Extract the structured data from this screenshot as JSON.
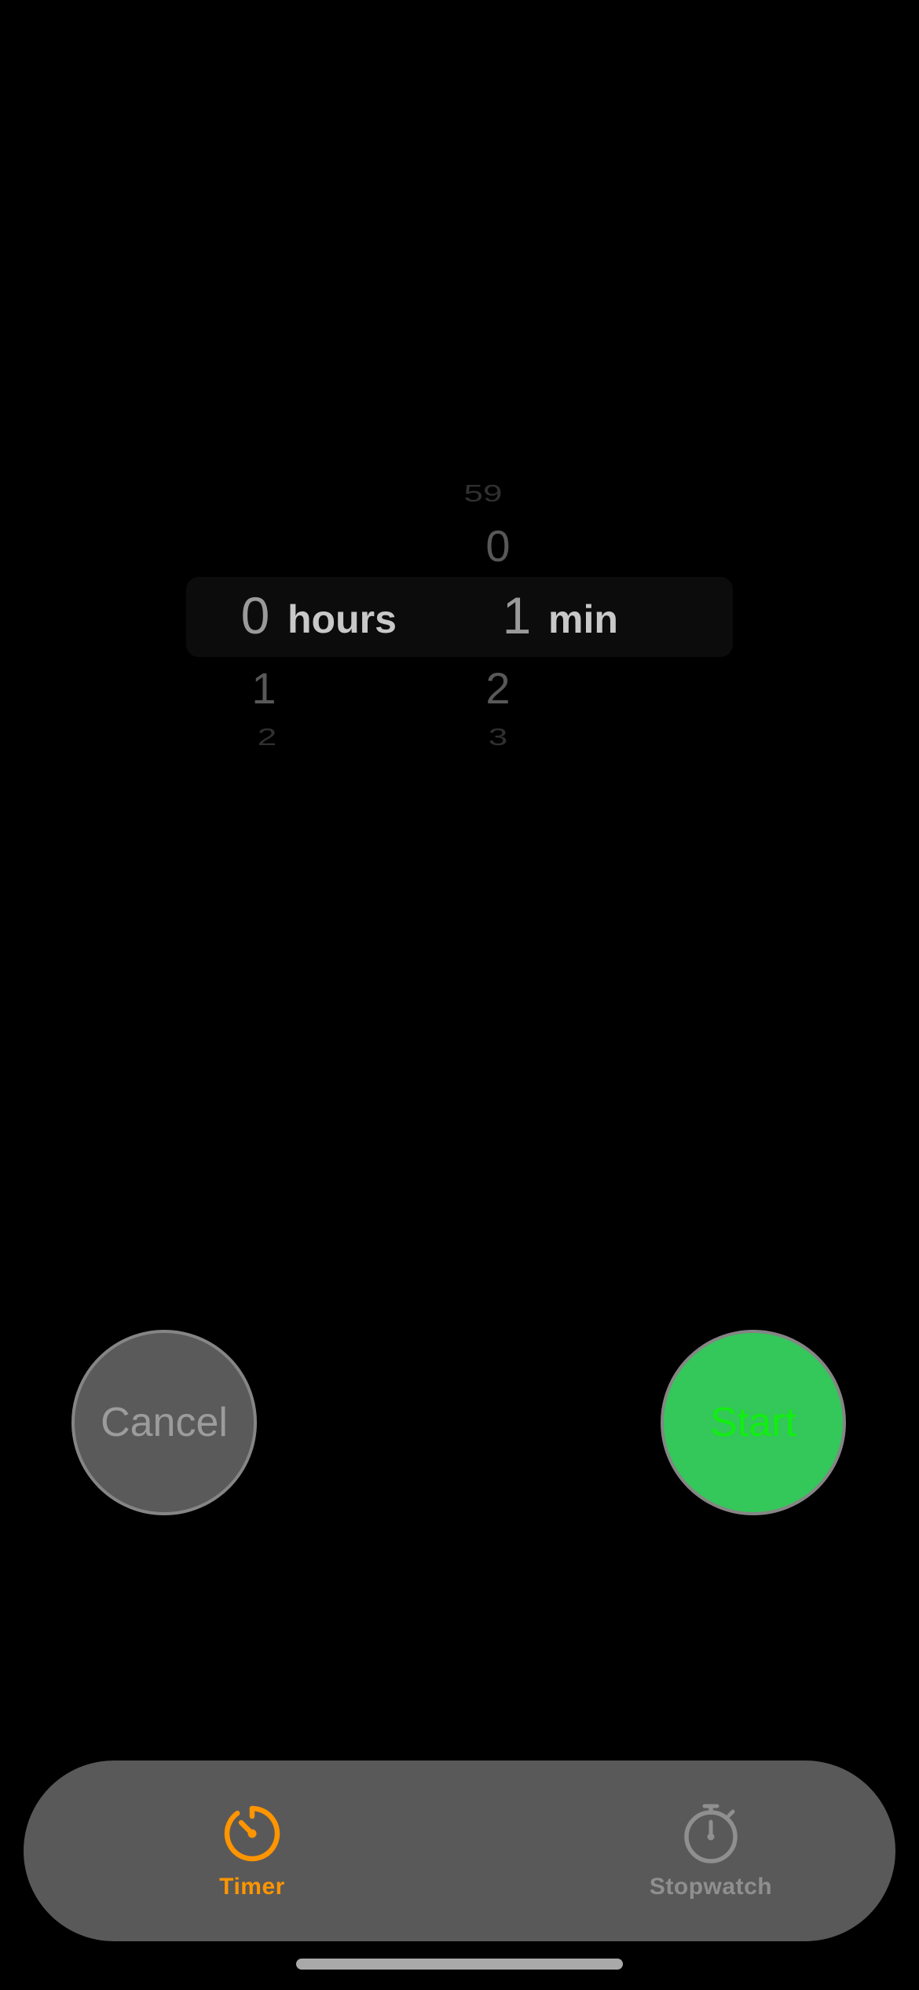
{
  "picker": {
    "hours": {
      "selected": "0",
      "unit": "hours",
      "below": [
        "1",
        "2"
      ]
    },
    "minutes": {
      "above": [
        "59",
        "0"
      ],
      "selected": "1",
      "unit": "min",
      "below": [
        "2",
        "3"
      ]
    }
  },
  "buttons": {
    "cancel_label": "Cancel",
    "start_label": "Start"
  },
  "tab_bar": {
    "tabs": [
      {
        "label": "Timer",
        "icon": "timer-icon",
        "active": true
      },
      {
        "label": "Stopwatch",
        "icon": "stopwatch-icon",
        "active": false
      }
    ]
  },
  "colors": {
    "accent_orange": "#ff9500",
    "start_green": "#34c759",
    "start_text_green": "#12ee12",
    "cancel_gray": "#5a5a5a",
    "tab_bar_bg": "#595959"
  }
}
